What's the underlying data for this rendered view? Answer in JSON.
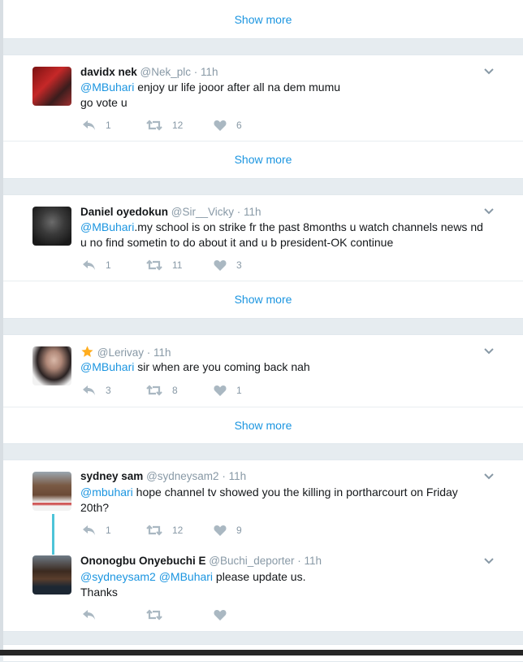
{
  "show_more_label": "Show more",
  "tweets": [
    {
      "name": "davidx nek",
      "handle": "@Nek_plc",
      "time": "· 11h",
      "mention": "@MBuhari",
      "text": " enjoy ur life jooor after all na dem mumu",
      "text2": " go vote u",
      "replies": "1",
      "retweets": "12",
      "likes": "6"
    },
    {
      "name": "Daniel oyedokun",
      "handle": "@Sir__Vicky",
      "time": "· 11h",
      "mention": "@MBuhari",
      "text": ".my school is on strike fr the past 8months u watch channels news nd",
      "text2": "u no find sometin to do about it and u b president-OK continue",
      "replies": "1",
      "retweets": "11",
      "likes": "3"
    },
    {
      "name": "",
      "handle": "@Lerivay",
      "time": "· 11h",
      "mention": "@MBuhari",
      "text": " sir when are you coming back nah",
      "replies": "3",
      "retweets": "8",
      "likes": "1"
    },
    {
      "name": "sydney sam",
      "handle": "@sydneysam2",
      "time": "· 11h",
      "mention": "@mbuhari",
      "text": " hope channel tv showed you the killing in portharcourt on Friday",
      "text2": "20th?",
      "replies": "1",
      "retweets": "12",
      "likes": "9"
    },
    {
      "name": "Ononogbu Onyebuchi E",
      "handle": "@Buchi_deporter",
      "time": "· 11h",
      "mention": "@sydneysam2",
      "mention2": "@MBuhari",
      "text": " please update us.",
      "text2": "Thanks"
    }
  ],
  "colors": {
    "link": "#1b95e0",
    "muted": "#8899a6",
    "thread": "#4dc4d8",
    "star": "#ffad1f"
  }
}
